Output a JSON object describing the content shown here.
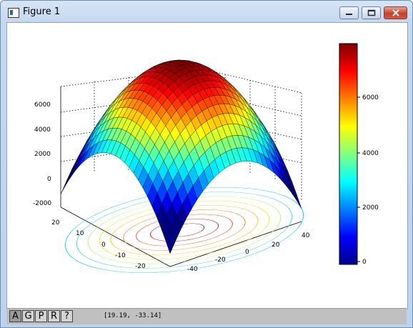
{
  "window": {
    "title": "Figure 1"
  },
  "status": {
    "buttons": [
      "A",
      "G",
      "P",
      "R",
      "?"
    ],
    "coords": "[19.19, -33.14]"
  },
  "chart_data": {
    "type": "surface",
    "z_ticks": [
      "6000",
      "4000",
      "2000",
      "0",
      "-2000"
    ],
    "x_ticks": [
      "40",
      "20",
      "0",
      "-20",
      "-40"
    ],
    "y_ticks": [
      "20",
      "10",
      "0",
      "-10",
      "-20"
    ],
    "colorbar_ticks": [
      "6000",
      "4000",
      "2000",
      "0"
    ],
    "colormap": "jet",
    "z_range": [
      -2000,
      6000
    ],
    "colorbar_range": [
      0,
      7500
    ],
    "contours_on_floor": true,
    "grid": true
  }
}
